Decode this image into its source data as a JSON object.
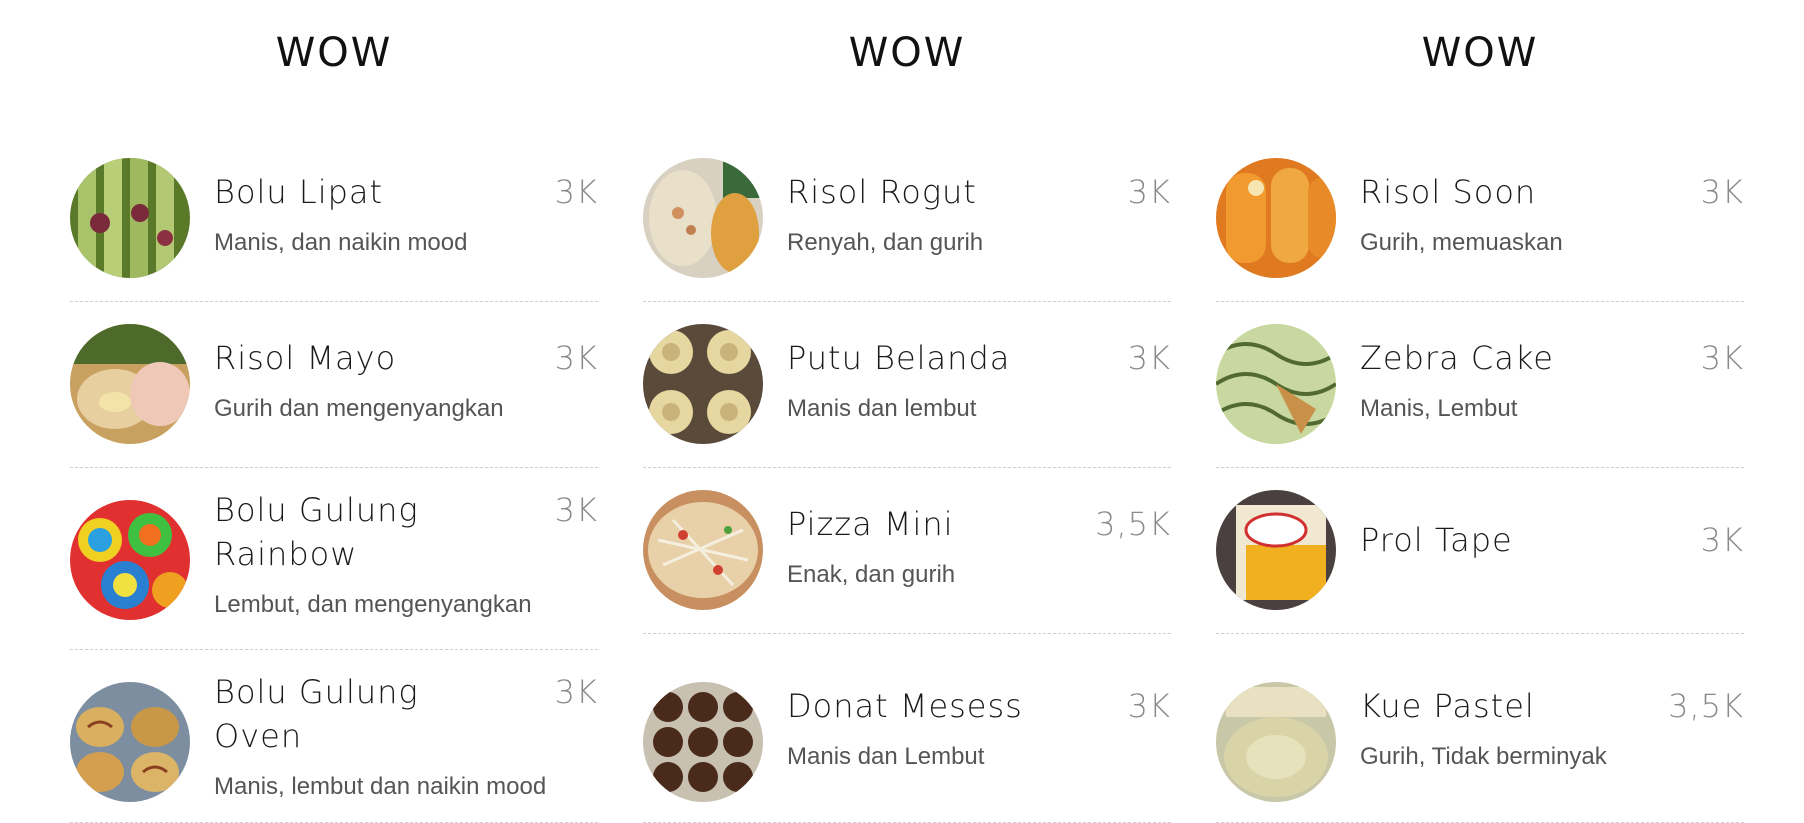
{
  "columns": [
    {
      "title": "WOW",
      "items": [
        {
          "name": "Bolu Lipat",
          "price": "3K",
          "desc": "Manis, dan naikin mood",
          "thumb": "bolu-lipat-photo"
        },
        {
          "name": "Risol Mayo",
          "price": "3K",
          "desc": "Gurih dan mengenyangkan",
          "thumb": "risol-mayo-photo"
        },
        {
          "name": "Bolu Gulung Rainbow",
          "price": "3K",
          "desc": "Lembut, dan mengenyangkan",
          "thumb": "bolu-gulung-rainbow-photo"
        },
        {
          "name": "Bolu Gulung Oven",
          "price": "3K",
          "desc": "Manis, lembut dan naikin mood",
          "thumb": "bolu-gulung-oven-photo"
        }
      ]
    },
    {
      "title": "WOW",
      "items": [
        {
          "name": "Risol Rogut",
          "price": "3K",
          "desc": "Renyah, dan gurih",
          "thumb": "risol-rogut-photo"
        },
        {
          "name": "Putu Belanda",
          "price": "3K",
          "desc": "Manis dan lembut",
          "thumb": "putu-belanda-photo"
        },
        {
          "name": "Pizza Mini",
          "price": "3,5K",
          "desc": "Enak, dan gurih",
          "thumb": "pizza-mini-photo"
        },
        {
          "name": "Donat Mesess",
          "price": "3K",
          "desc": "Manis dan Lembut",
          "thumb": "donat-mesess-photo"
        }
      ]
    },
    {
      "title": "WOW",
      "items": [
        {
          "name": "Risol Soon",
          "price": "3K",
          "desc": "Gurih, memuaskan",
          "thumb": "risol-soon-photo"
        },
        {
          "name": "Zebra Cake",
          "price": "3K",
          "desc": "Manis, Lembut",
          "thumb": "zebra-cake-photo"
        },
        {
          "name": "Prol Tape",
          "price": "3K",
          "desc": "",
          "thumb": "prol-tape-photo"
        },
        {
          "name": "Kue Pastel",
          "price": "3,5K",
          "desc": "Gurih, Tidak berminyak",
          "thumb": "kue-pastel-photo"
        }
      ]
    }
  ]
}
